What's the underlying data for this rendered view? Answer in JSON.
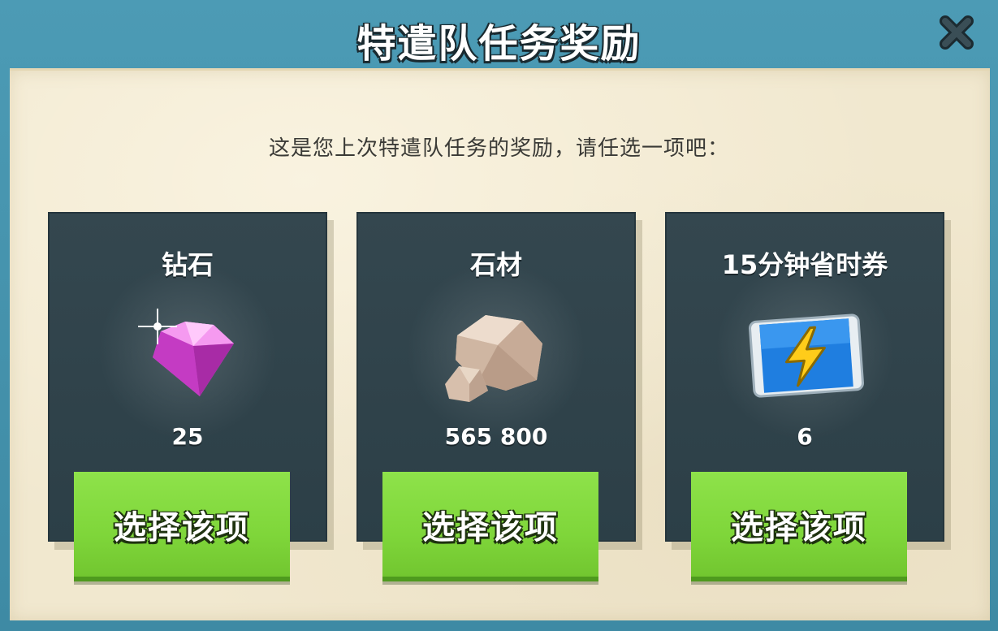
{
  "dialog": {
    "title": "特遣队任务奖励",
    "subtitle": "这是您上次特遣队任务的奖励，请任选一项吧："
  },
  "rewards": [
    {
      "name": "钻石",
      "amount": "25",
      "icon": "diamond-icon",
      "button_label": "选择该项"
    },
    {
      "name": "石材",
      "amount": "565 800",
      "icon": "stone-icon",
      "button_label": "选择该项"
    },
    {
      "name": "15分钟省时券",
      "amount": "6",
      "icon": "time-saver-ticket-icon",
      "button_label": "选择该项"
    }
  ],
  "colors": {
    "frame": "#3f8fa9",
    "paper": "#f1e8cf",
    "card": "#2f424a",
    "button": "#7fd63a"
  }
}
